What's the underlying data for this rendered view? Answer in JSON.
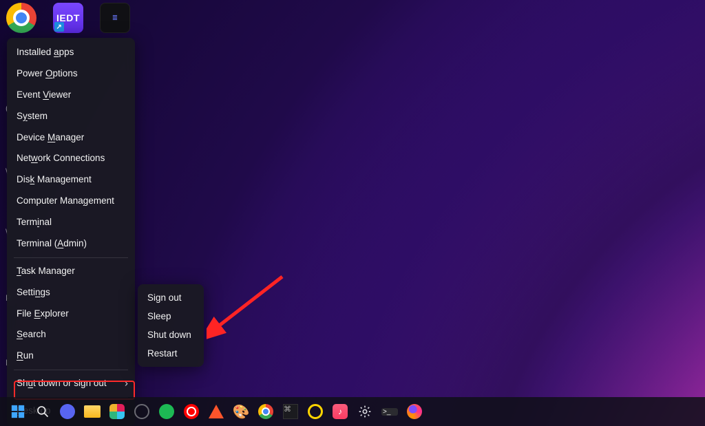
{
  "desktop_icons": {
    "chrome_alt": "Google Chrome",
    "iedt_label": "IEDT",
    "dark_alt": "App"
  },
  "winx_menu": {
    "items": [
      {
        "pre": "Installed ",
        "u": "a",
        "post": "pps"
      },
      {
        "pre": "Power ",
        "u": "O",
        "post": "ptions"
      },
      {
        "pre": "Event ",
        "u": "V",
        "post": "iewer"
      },
      {
        "pre": "S",
        "u": "y",
        "post": "stem"
      },
      {
        "pre": "Device ",
        "u": "M",
        "post": "anager"
      },
      {
        "pre": "Net",
        "u": "w",
        "post": "ork Connections"
      },
      {
        "pre": "Dis",
        "u": "k",
        "post": " Management"
      },
      {
        "pre": "Computer Mana",
        "u": "g",
        "post": "ement"
      },
      {
        "pre": "Term",
        "u": "i",
        "post": "nal"
      },
      {
        "pre": "Terminal (",
        "u": "A",
        "post": "dmin)"
      },
      {
        "pre": "",
        "u": "T",
        "post": "ask Manager"
      },
      {
        "pre": "Setti",
        "u": "n",
        "post": "gs"
      },
      {
        "pre": "File ",
        "u": "E",
        "post": "xplorer"
      },
      {
        "pre": "",
        "u": "S",
        "post": "earch"
      },
      {
        "pre": "",
        "u": "R",
        "post": "un"
      },
      {
        "pre": "Sh",
        "u": "u",
        "post": "t down or sign out"
      },
      {
        "pre": "",
        "u": "D",
        "post": "esktop"
      }
    ]
  },
  "submenu": {
    "items": [
      {
        "pre": "Sign ",
        "u": "o",
        "post": "ut"
      },
      {
        "pre": "",
        "u": "S",
        "post": "leep"
      },
      {
        "pre": "Sh",
        "u": "u",
        "post": "t down"
      },
      {
        "pre": "",
        "u": "R",
        "post": "estart"
      }
    ]
  },
  "taskbar": {
    "start": "Start",
    "search": "Search",
    "apps": [
      "discord",
      "file-explorer",
      "slack",
      "obs",
      "spotify",
      "youtube-music",
      "brave",
      "paint",
      "chrome",
      "kitty",
      "obs-small",
      "apple-music",
      "settings",
      "terminal",
      "firefox"
    ]
  },
  "annotation": {
    "highlighted_item": "Shut down or sign out",
    "arrow_target": "Shut down"
  }
}
